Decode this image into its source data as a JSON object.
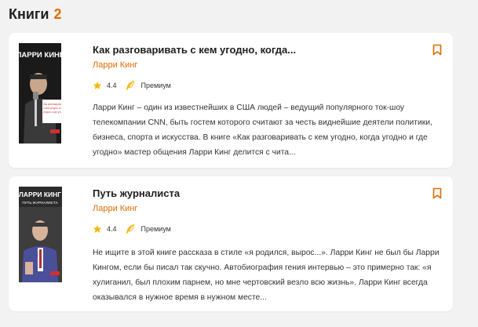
{
  "section": {
    "title": "Книги",
    "count": "2"
  },
  "colors": {
    "accent": "#e06b00",
    "card_bg": "#ffffff",
    "page_bg": "#f2f2f2",
    "star": "#f5b800"
  },
  "books": [
    {
      "title": "Как разговаривать с кем угодно, когда...",
      "author": "Ларри Кинг",
      "rating": "4.4",
      "badge": "Премиум",
      "description": "Ларри Кинг – один из известнейших в США людей – ведущий популярного ток-шоу телекомпании CNN, быть гостем которого считают за честь виднейшие деятели политики, бизнеса, спорта и искусства. В книге «Как разговаривать с кем угодно, когда угодно и где угодно» мастер общения Ларри Кинг делится с чита...",
      "cover": {
        "name": "ЛАРРИ КИНГ",
        "subtitle": "Как разговаривать с кем угодно, когда угодно и где угодно"
      }
    },
    {
      "title": "Путь журналиста",
      "author": "Ларри Кинг",
      "rating": "4.4",
      "badge": "Премиум",
      "description": "Не ищите в этой книге рассказа в стиле «я родился, вырос...». Ларри Кинг не был бы Ларри Кингом, если бы писал так скучно. Автобиография гения интервью – это примерно так: «я хулиганил, был плохим парнем, но мне чертовский везло всю жизнь». Ларри Кинг всегда оказывался в нужное время в нужном месте...",
      "cover": {
        "name": "ЛАРРИ КИНГ",
        "subtitle": "ПУТЬ ЖУРНАЛИСТА"
      }
    }
  ]
}
